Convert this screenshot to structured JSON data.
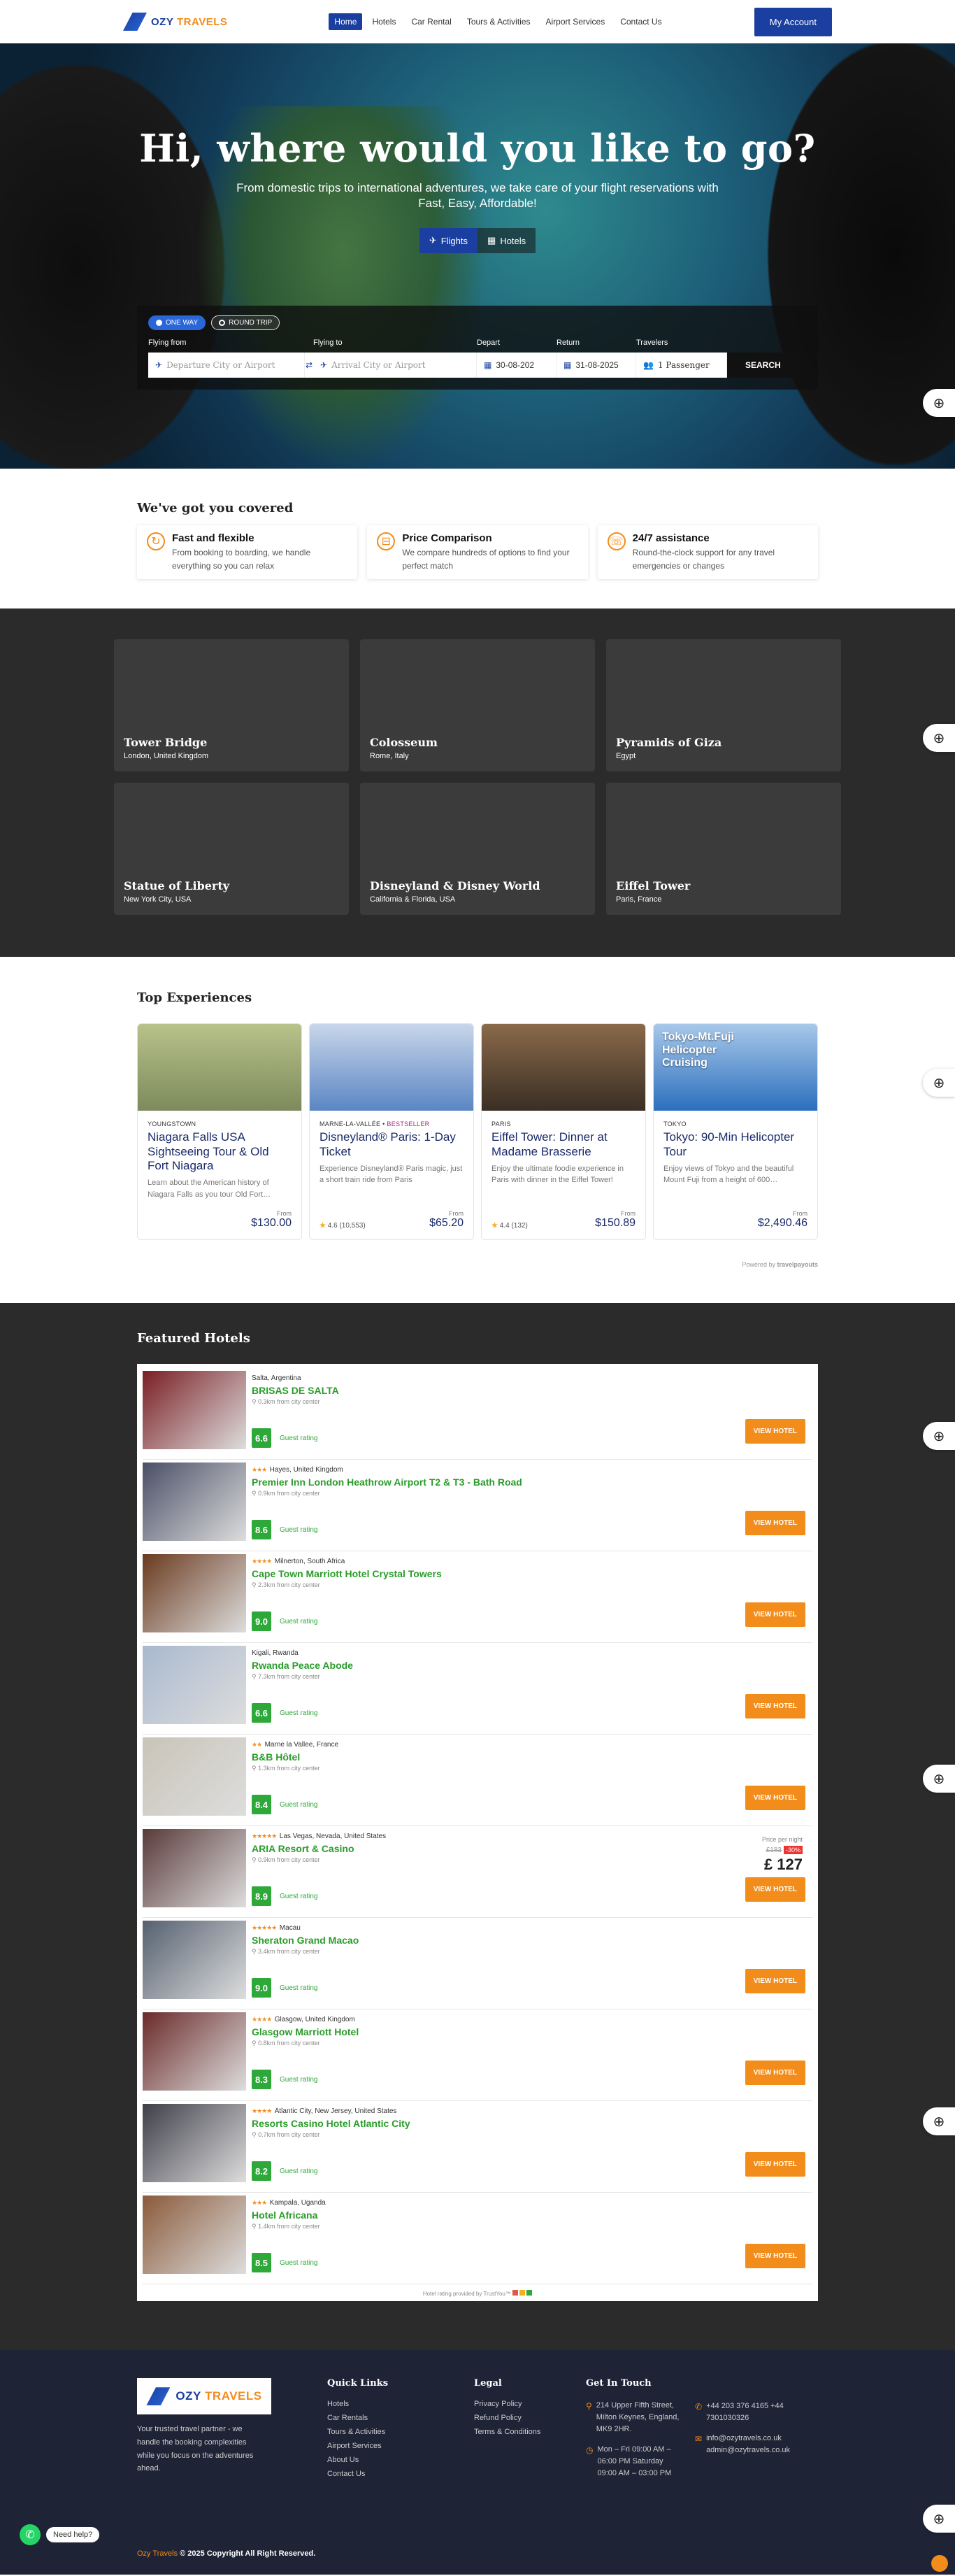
{
  "nav": {
    "logo_text": "OZY",
    "logo_text_accent": "TRAVELS",
    "items": [
      {
        "label": "Home",
        "active": true
      },
      {
        "label": "Hotels",
        "active": false
      },
      {
        "label": "Car Rental",
        "active": false
      },
      {
        "label": "Tours & Activities",
        "active": false
      },
      {
        "label": "Airport Services",
        "active": false
      },
      {
        "label": "Contact Us",
        "active": false
      }
    ],
    "account_label": "My Account"
  },
  "hero": {
    "title": "Hi, where would you like to go?",
    "subtitle_line1": "From domestic trips to international adventures, we take care of your flight reservations with",
    "subtitle_line2": "Fast, Easy, Affordable!",
    "tabs": [
      {
        "label": "Flights"
      },
      {
        "label": "Hotels"
      }
    ],
    "trip_options": [
      {
        "label": "ONE WAY"
      },
      {
        "label": "ROUND TRIP"
      }
    ],
    "labels": {
      "from": "Flying from",
      "to": "Flying to",
      "depart": "Depart",
      "return": "Return",
      "travelers": "Travelers"
    },
    "from_placeholder": "Departure City or Airport",
    "to_placeholder": "Arrival City or Airport",
    "depart_value": "30-08-202",
    "return_value": "31-08-2025",
    "travelers_value": "1 Passenger",
    "search_label": "SEARCH"
  },
  "covered": {
    "title": "We've got you covered",
    "items": [
      {
        "title": "Fast and flexible",
        "text": "From booking to boarding, we handle everything so you can relax"
      },
      {
        "title": "Price Comparison",
        "text": "We compare hundreds of options to find your perfect match"
      },
      {
        "title": "24/7 assistance",
        "text": "Round-the-clock support for any travel emergencies or changes"
      }
    ]
  },
  "destinations": [
    {
      "name": "Tower Bridge",
      "location": "London, United Kingdom"
    },
    {
      "name": "Colosseum",
      "location": "Rome, Italy"
    },
    {
      "name": "Pyramids of Giza",
      "location": "Egypt"
    },
    {
      "name": "Statue of Liberty",
      "location": "New York City, USA"
    },
    {
      "name": "Disneyland & Disney World",
      "location": "California & Florida, USA"
    },
    {
      "name": "Eiffel Tower",
      "location": "Paris, France"
    }
  ],
  "experiences": {
    "title": "Top Experiences",
    "items": [
      {
        "location": "YOUNGSTOWN",
        "badge": "",
        "title": "Niagara Falls USA Sightseeing Tour & Old Fort Niagara",
        "desc": "Learn about the American history of Niagara Falls as you tour Old Fort…",
        "rating": "",
        "price_label": "From",
        "price": "$130.00",
        "color1": "#7d8a5c",
        "color2": "#b8c28a"
      },
      {
        "location": "MARNE-LA-VALLÉE",
        "badge": "BESTSELLER",
        "title": "Disneyland® Paris: 1-Day Ticket",
        "desc": "Experience Disneyland® Paris magic, just a short train ride from Paris",
        "rating": "4.6 (10,553)",
        "price_label": "From",
        "price": "$65.20",
        "color1": "#5a86c4",
        "color2": "#c9d6ea"
      },
      {
        "location": "PARIS",
        "badge": "",
        "title": "Eiffel Tower: Dinner at Madame Brasserie",
        "desc": "Enjoy the ultimate foodie experience in Paris with dinner in the Eiffel Tower!",
        "rating": "4.4 (132)",
        "price_label": "From",
        "price": "$150.89",
        "color1": "#3a2e24",
        "color2": "#8a6a4a"
      },
      {
        "location": "TOKYO",
        "badge": "",
        "title": "Tokyo: 90-Min Helicopter Tour",
        "desc": "Enjoy views of Tokyo and the beautiful Mount Fuji from a height of 600…",
        "rating": "",
        "price_label": "From",
        "price": "$2,490.46",
        "color1": "#2b6fbd",
        "color2": "#a8c8ea",
        "image_text": "Tokyo-Mt.Fuji Helicopter Cruising"
      }
    ],
    "powered_by": "Powered by",
    "powered_brand": "travelpayouts"
  },
  "hotels": {
    "title": "Featured Hotels",
    "view_label": "VIEW HOTEL",
    "rating_label": "Guest rating",
    "items": [
      {
        "stars": "",
        "location": "Salta, Argentina",
        "name": "BRISAS DE SALTA",
        "distance": "0.3km from city center",
        "score": "6.6",
        "img": "#7a1f24"
      },
      {
        "stars": "★★★",
        "location": "Hayes, United Kingdom",
        "name": "Premier Inn London Heathrow Airport T2 & T3 - Bath Road",
        "distance": "0.9km from city center",
        "score": "8.6",
        "img": "#4a4f66"
      },
      {
        "stars": "★★★★",
        "location": "Milnerton, South Africa",
        "name": "Cape Town Marriott Hotel Crystal Towers",
        "distance": "2.3km from city center",
        "score": "9.0",
        "img": "#6a3a1e"
      },
      {
        "stars": "",
        "location": "Kigali, Rwanda",
        "name": "Rwanda Peace Abode",
        "distance": "7.3km from city center",
        "score": "6.6",
        "img": "#a9b9cf"
      },
      {
        "stars": "★★",
        "location": "Marne la Vallee, France",
        "name": "B&B Hôtel",
        "distance": "1.3km from city center",
        "score": "8.4",
        "img": "#c9c4b8"
      },
      {
        "stars": "★★★★★",
        "location": "Las Vegas, Nevada, United States",
        "name": "ARIA Resort & Casino",
        "distance": "0.9km from city center",
        "score": "8.9",
        "img": "#5a3a3a",
        "price_label": "Price per night",
        "old_price": "£183",
        "discount": "-30%",
        "price": "£ 127"
      },
      {
        "stars": "★★★★★",
        "location": "Macau",
        "name": "Sheraton Grand Macao",
        "distance": "3.4km from city center",
        "score": "9.0",
        "img": "#556070"
      },
      {
        "stars": "★★★★",
        "location": "Glasgow, United Kingdom",
        "name": "Glasgow Marriott Hotel",
        "distance": "0.8km from city center",
        "score": "8.3",
        "img": "#6b2a2a"
      },
      {
        "stars": "★★★★",
        "location": "Atlantic City, New Jersey, United States",
        "name": "Resorts Casino Hotel Atlantic City",
        "distance": "0.7km from city center",
        "score": "8.2",
        "img": "#3f3f4a"
      },
      {
        "stars": "★★★",
        "location": "Kampala, Uganda",
        "name": "Hotel Africana",
        "distance": "1.4km from city center",
        "score": "8.5",
        "img": "#8a5a3a"
      }
    ],
    "tripadvisor_note": "Hotel rating provided by TrustYou™"
  },
  "footer": {
    "about": "Your trusted travel partner - we handle the booking complexities while you focus on the adventures ahead.",
    "quick_title": "Quick Links",
    "quick_links": [
      "Hotels",
      "Car Rentals",
      "Tours & Activities",
      "Airport Services",
      "About Us",
      "Contact Us"
    ],
    "legal_title": "Legal",
    "legal_links": [
      "Privacy Policy",
      "Refund Policy",
      "Terms & Conditions"
    ],
    "contact_title": "Get In Touch",
    "address": "214 Upper Fifth Street, Milton Keynes, England, MK9 2HR.",
    "hours": "Mon – Fri 09:00 AM – 06:00 PM Saturday 09:00 AM – 03:00 PM",
    "phones": "+44 203 376 4165 +44 7301030326",
    "emails": "info@ozytravels.co.uk admin@ozytravels.co.uk",
    "copyright_brand": "Ozy Travels",
    "copyright_rest": "© 2025 Copyright All Right Reserved.",
    "help_label": "Need help?"
  },
  "colors": {
    "primary": "#1a3fa0",
    "accent": "#f28c1b",
    "rating_green": "#2fa83a",
    "dark_section": "#2b2b2b",
    "footer": "#1f2336"
  }
}
